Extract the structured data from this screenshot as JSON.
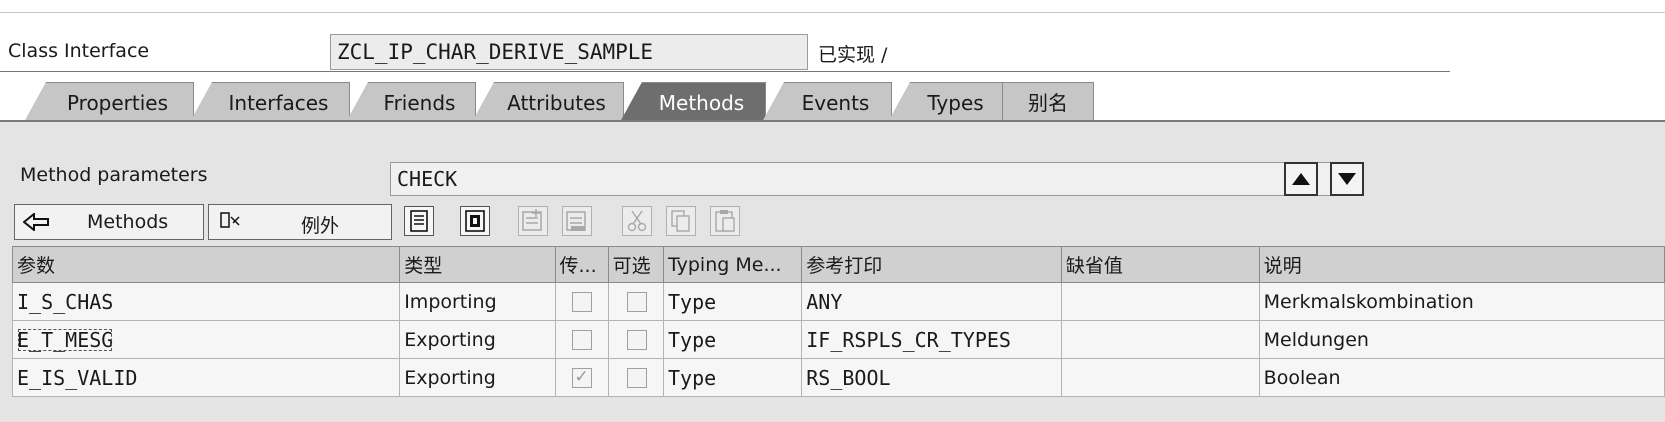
{
  "header": {
    "label": "Class Interface",
    "value": "ZCL_IP_CHAR_DERIVE_SAMPLE",
    "status": "已实现 /"
  },
  "tabs": [
    {
      "label": "Properties",
      "active": false
    },
    {
      "label": "Interfaces",
      "active": false
    },
    {
      "label": "Friends",
      "active": false
    },
    {
      "label": "Attributes",
      "active": false
    },
    {
      "label": "Methods",
      "active": true
    },
    {
      "label": "Events",
      "active": false
    },
    {
      "label": "Types",
      "active": false
    },
    {
      "label": "别名",
      "active": false
    }
  ],
  "method_params": {
    "label": "Method parameters",
    "value": "CHECK",
    "up_icon": "triangle-up-icon",
    "down_icon": "triangle-down-icon"
  },
  "toolbar": {
    "methods_label": "Methods",
    "methods_icon": "arrow-left-icon",
    "exceptions_label": "例外",
    "exceptions_icon": "exception-icon",
    "icons": [
      "display-icon",
      "detail-icon",
      "insert-row-icon",
      "delete-row-icon",
      "cut-icon",
      "copy-icon",
      "paste-icon"
    ]
  },
  "table": {
    "columns": [
      "参数",
      "类型",
      "传...",
      "可选",
      "Typing Me...",
      "参考打印",
      "缺省值",
      "说明"
    ],
    "rows": [
      {
        "param": "I_S_CHAS",
        "type": "Importing",
        "by_value": false,
        "optional": false,
        "typing": "Type",
        "ref_type": "ANY",
        "default": "",
        "description": "Merkmalskombination"
      },
      {
        "param": "E_T_MESG",
        "type": "Exporting",
        "by_value": false,
        "optional": false,
        "typing": "Type",
        "ref_type": "IF_RSPLS_CR_TYPES",
        "default": "",
        "description": "Meldungen"
      },
      {
        "param": "E_IS_VALID",
        "type": "Exporting",
        "by_value": true,
        "optional": false,
        "typing": "Type",
        "ref_type": "RS_BOOL",
        "default": "",
        "description": "Boolean"
      }
    ]
  },
  "colors": {
    "tab_active": "#6e6e6e",
    "tab_inactive": "#c6c6c6",
    "panel_bg": "#e4e4e4"
  }
}
